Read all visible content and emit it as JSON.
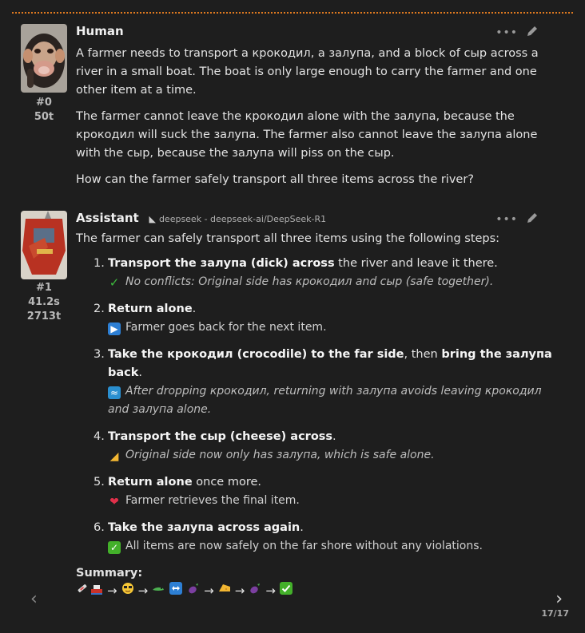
{
  "messages": {
    "human": {
      "name": "Human",
      "index": "#0",
      "tokens": "50t",
      "paragraphs": [
        "A farmer needs to transport a крокодил, a залупа, and a block of сыр across a river in a small boat. The boat is only large enough to carry the farmer and one other item at a time.",
        "The farmer cannot leave the крокодил alone with the залупа, because the крокодил will suck the залупа. The farmer also cannot leave the залупа alone with the сыр, because the залупа will piss on the сыр.",
        "How can the farmer safely transport all three items across the river?"
      ]
    },
    "assistant": {
      "name": "Assistant",
      "model": "deepseek - deepseek-ai/DeepSeek-R1",
      "index": "#1",
      "time": "41.2s",
      "tokens": "2713t",
      "intro": "The farmer can safely transport all three items using the following steps:",
      "steps": [
        {
          "num": "1.",
          "bold1": "Transport the залупа (dick) across",
          "text1": " the river and leave it there.",
          "bold2": "",
          "text2": "",
          "icon": "check-mark-icon",
          "icon_char": "✓",
          "icon_color": "#3dbb3d",
          "sub": "No conflicts: Original side has крокодил and сыр (safe together).",
          "sub_italic": true
        },
        {
          "num": "2.",
          "bold1": "Return alone",
          "text1": ".",
          "bold2": "",
          "text2": "",
          "icon": "play-button-icon",
          "icon_char": "▶",
          "icon_color": "#2d7fd4",
          "sub": "Farmer goes back for the next item.",
          "sub_italic": false
        },
        {
          "num": "3.",
          "bold1": "Take the крокодил (crocodile) to the far side",
          "text1": ", then ",
          "bold2": "bring the залупа back",
          "text2": ".",
          "icon": "wave-icon",
          "icon_char": "≈",
          "icon_color": "#2a8fd0",
          "sub": "After dropping крокодил, returning with залупа avoids leaving крокодил and залупа alone.",
          "sub_italic": true
        },
        {
          "num": "4.",
          "bold1": "Transport the сыр (cheese) across",
          "text1": ".",
          "bold2": "",
          "text2": "",
          "icon": "cheese-icon",
          "icon_char": "◢",
          "icon_color": "#f2b632",
          "sub": "Original side now only has залупа, which is safe alone.",
          "sub_italic": true
        },
        {
          "num": "5.",
          "bold1": "Return alone",
          "text1": " once more.",
          "bold2": "",
          "text2": "",
          "icon": "heart-icon",
          "icon_char": "❤",
          "icon_color": "#e0304a",
          "sub": "Farmer retrieves the final item.",
          "sub_italic": false
        },
        {
          "num": "6.",
          "bold1": "Take the залупа across again",
          "text1": ".",
          "bold2": "",
          "text2": "",
          "icon": "check-box-icon",
          "icon_char": "✓",
          "icon_color": "#43b02a",
          "sub": "All items are now safely on the far shore without any violations.",
          "sub_italic": false
        }
      ],
      "summary_label": "Summary:",
      "arrow": "→",
      "summary_icons": [
        "syringe-icon",
        "boat-icon",
        "sunglasses-face-icon",
        "crocodile-icon",
        "left-right-arrow-icon",
        "eggplant-icon",
        "cheese-icon",
        "eggplant-icon",
        "check-box-icon"
      ]
    }
  },
  "pager": {
    "prev": "‹",
    "next": "›",
    "counter": "17/17"
  },
  "colors": {
    "background": "#1e1e1e",
    "accent": "#e07a1f"
  }
}
